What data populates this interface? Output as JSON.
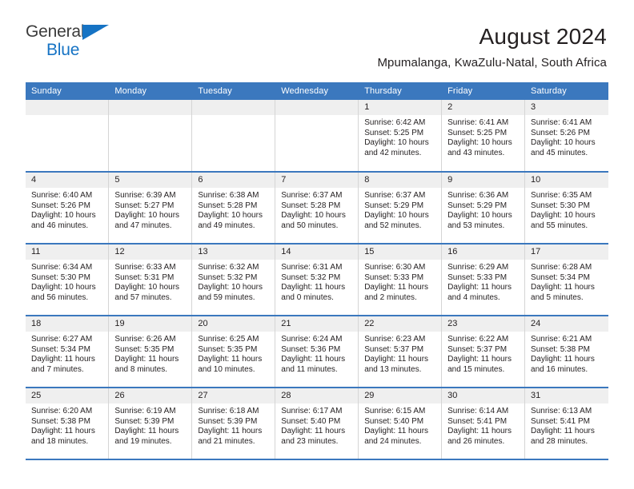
{
  "brand": {
    "name_part1": "General",
    "name_part2": "Blue"
  },
  "header": {
    "title": "August 2024",
    "subtitle": "Mpumalanga, KwaZulu-Natal, South Africa"
  },
  "colors": {
    "header_blue": "#3b78be",
    "daynum_gray": "#efefef",
    "logo_blue": "#1673c4",
    "text": "#231f20"
  },
  "weekday_headers": [
    "Sunday",
    "Monday",
    "Tuesday",
    "Wednesday",
    "Thursday",
    "Friday",
    "Saturday"
  ],
  "weeks": [
    [
      {
        "day": "",
        "empty": true
      },
      {
        "day": "",
        "empty": true
      },
      {
        "day": "",
        "empty": true
      },
      {
        "day": "",
        "empty": true
      },
      {
        "day": "1",
        "sunrise": "Sunrise: 6:42 AM",
        "sunset": "Sunset: 5:25 PM",
        "daylight": "Daylight: 10 hours and 42 minutes."
      },
      {
        "day": "2",
        "sunrise": "Sunrise: 6:41 AM",
        "sunset": "Sunset: 5:25 PM",
        "daylight": "Daylight: 10 hours and 43 minutes."
      },
      {
        "day": "3",
        "sunrise": "Sunrise: 6:41 AM",
        "sunset": "Sunset: 5:26 PM",
        "daylight": "Daylight: 10 hours and 45 minutes."
      }
    ],
    [
      {
        "day": "4",
        "sunrise": "Sunrise: 6:40 AM",
        "sunset": "Sunset: 5:26 PM",
        "daylight": "Daylight: 10 hours and 46 minutes."
      },
      {
        "day": "5",
        "sunrise": "Sunrise: 6:39 AM",
        "sunset": "Sunset: 5:27 PM",
        "daylight": "Daylight: 10 hours and 47 minutes."
      },
      {
        "day": "6",
        "sunrise": "Sunrise: 6:38 AM",
        "sunset": "Sunset: 5:28 PM",
        "daylight": "Daylight: 10 hours and 49 minutes."
      },
      {
        "day": "7",
        "sunrise": "Sunrise: 6:37 AM",
        "sunset": "Sunset: 5:28 PM",
        "daylight": "Daylight: 10 hours and 50 minutes."
      },
      {
        "day": "8",
        "sunrise": "Sunrise: 6:37 AM",
        "sunset": "Sunset: 5:29 PM",
        "daylight": "Daylight: 10 hours and 52 minutes."
      },
      {
        "day": "9",
        "sunrise": "Sunrise: 6:36 AM",
        "sunset": "Sunset: 5:29 PM",
        "daylight": "Daylight: 10 hours and 53 minutes."
      },
      {
        "day": "10",
        "sunrise": "Sunrise: 6:35 AM",
        "sunset": "Sunset: 5:30 PM",
        "daylight": "Daylight: 10 hours and 55 minutes."
      }
    ],
    [
      {
        "day": "11",
        "sunrise": "Sunrise: 6:34 AM",
        "sunset": "Sunset: 5:30 PM",
        "daylight": "Daylight: 10 hours and 56 minutes."
      },
      {
        "day": "12",
        "sunrise": "Sunrise: 6:33 AM",
        "sunset": "Sunset: 5:31 PM",
        "daylight": "Daylight: 10 hours and 57 minutes."
      },
      {
        "day": "13",
        "sunrise": "Sunrise: 6:32 AM",
        "sunset": "Sunset: 5:32 PM",
        "daylight": "Daylight: 10 hours and 59 minutes."
      },
      {
        "day": "14",
        "sunrise": "Sunrise: 6:31 AM",
        "sunset": "Sunset: 5:32 PM",
        "daylight": "Daylight: 11 hours and 0 minutes."
      },
      {
        "day": "15",
        "sunrise": "Sunrise: 6:30 AM",
        "sunset": "Sunset: 5:33 PM",
        "daylight": "Daylight: 11 hours and 2 minutes."
      },
      {
        "day": "16",
        "sunrise": "Sunrise: 6:29 AM",
        "sunset": "Sunset: 5:33 PM",
        "daylight": "Daylight: 11 hours and 4 minutes."
      },
      {
        "day": "17",
        "sunrise": "Sunrise: 6:28 AM",
        "sunset": "Sunset: 5:34 PM",
        "daylight": "Daylight: 11 hours and 5 minutes."
      }
    ],
    [
      {
        "day": "18",
        "sunrise": "Sunrise: 6:27 AM",
        "sunset": "Sunset: 5:34 PM",
        "daylight": "Daylight: 11 hours and 7 minutes."
      },
      {
        "day": "19",
        "sunrise": "Sunrise: 6:26 AM",
        "sunset": "Sunset: 5:35 PM",
        "daylight": "Daylight: 11 hours and 8 minutes."
      },
      {
        "day": "20",
        "sunrise": "Sunrise: 6:25 AM",
        "sunset": "Sunset: 5:35 PM",
        "daylight": "Daylight: 11 hours and 10 minutes."
      },
      {
        "day": "21",
        "sunrise": "Sunrise: 6:24 AM",
        "sunset": "Sunset: 5:36 PM",
        "daylight": "Daylight: 11 hours and 11 minutes."
      },
      {
        "day": "22",
        "sunrise": "Sunrise: 6:23 AM",
        "sunset": "Sunset: 5:37 PM",
        "daylight": "Daylight: 11 hours and 13 minutes."
      },
      {
        "day": "23",
        "sunrise": "Sunrise: 6:22 AM",
        "sunset": "Sunset: 5:37 PM",
        "daylight": "Daylight: 11 hours and 15 minutes."
      },
      {
        "day": "24",
        "sunrise": "Sunrise: 6:21 AM",
        "sunset": "Sunset: 5:38 PM",
        "daylight": "Daylight: 11 hours and 16 minutes."
      }
    ],
    [
      {
        "day": "25",
        "sunrise": "Sunrise: 6:20 AM",
        "sunset": "Sunset: 5:38 PM",
        "daylight": "Daylight: 11 hours and 18 minutes."
      },
      {
        "day": "26",
        "sunrise": "Sunrise: 6:19 AM",
        "sunset": "Sunset: 5:39 PM",
        "daylight": "Daylight: 11 hours and 19 minutes."
      },
      {
        "day": "27",
        "sunrise": "Sunrise: 6:18 AM",
        "sunset": "Sunset: 5:39 PM",
        "daylight": "Daylight: 11 hours and 21 minutes."
      },
      {
        "day": "28",
        "sunrise": "Sunrise: 6:17 AM",
        "sunset": "Sunset: 5:40 PM",
        "daylight": "Daylight: 11 hours and 23 minutes."
      },
      {
        "day": "29",
        "sunrise": "Sunrise: 6:15 AM",
        "sunset": "Sunset: 5:40 PM",
        "daylight": "Daylight: 11 hours and 24 minutes."
      },
      {
        "day": "30",
        "sunrise": "Sunrise: 6:14 AM",
        "sunset": "Sunset: 5:41 PM",
        "daylight": "Daylight: 11 hours and 26 minutes."
      },
      {
        "day": "31",
        "sunrise": "Sunrise: 6:13 AM",
        "sunset": "Sunset: 5:41 PM",
        "daylight": "Daylight: 11 hours and 28 minutes."
      }
    ]
  ]
}
